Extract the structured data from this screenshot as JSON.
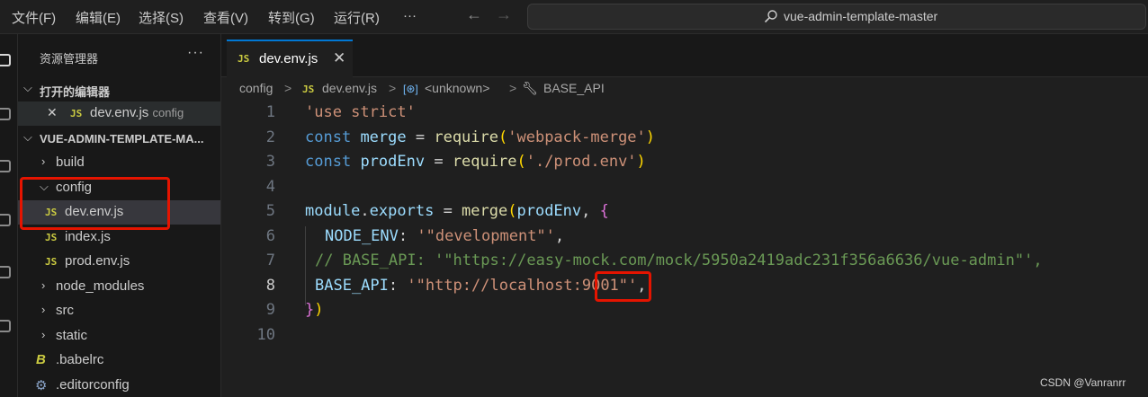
{
  "menu": [
    "文件(F)",
    "编辑(E)",
    "选择(S)",
    "查看(V)",
    "转到(G)",
    "运行(R)",
    "···"
  ],
  "nav": {
    "back": "←",
    "forward": "→"
  },
  "command_center": {
    "text": "vue-admin-template-master",
    "icon": "search-icon"
  },
  "sidebar": {
    "title": "资源管理器",
    "more": "···",
    "open_editors": {
      "title": "打开的编辑器",
      "items": [
        {
          "close": "✕",
          "badge": "JS",
          "name": "dev.env.js",
          "desc": "config"
        }
      ]
    },
    "project": {
      "title": "VUE-ADMIN-TEMPLATE-MA...",
      "folders": {
        "build": "build",
        "config": "config",
        "node_modules": "node_modules",
        "src": "src",
        "static": "static"
      },
      "config_files": [
        {
          "badge": "JS",
          "name": "dev.env.js"
        },
        {
          "badge": "JS",
          "name": "index.js"
        },
        {
          "badge": "JS",
          "name": "prod.env.js"
        }
      ],
      "babelrc": ".babelrc",
      "editorconfig": ".editorconfig"
    }
  },
  "tab": {
    "badge": "JS",
    "label": "dev.env.js",
    "close": "✕"
  },
  "breadcrumb": {
    "folder": "config",
    "file_badge": "JS",
    "file": "dev.env.js",
    "symbol1": "<unknown>",
    "symbol2": "BASE_API",
    "sep": ">"
  },
  "code": {
    "line_numbers": [
      "1",
      "2",
      "3",
      "4",
      "5",
      "6",
      "7",
      "8",
      "9",
      "10"
    ],
    "active_line": "8",
    "l1": {
      "s": "'use strict'"
    },
    "l2": {
      "kw": "const",
      "v": "merge",
      "eq": " = ",
      "fn": "require",
      "p1": "(",
      "s": "'webpack-merge'",
      "p2": ")"
    },
    "l3": {
      "kw": "const",
      "v": "prodEnv",
      "eq": " = ",
      "fn": "require",
      "p1": "(",
      "s": "'./prod.env'",
      "p2": ")"
    },
    "l5": {
      "m": "module",
      "dot": ".",
      "e": "exports",
      "eq": " = ",
      "fn": "merge",
      "p1": "(",
      "a": "prodEnv",
      "c": ", ",
      "b": "{"
    },
    "l6": {
      "k": "NODE_ENV",
      "c": ": ",
      "s": "'\"development\"'",
      "t": ","
    },
    "l7": {
      "cmt": "// BASE_API: '\"https://easy-mock.com/mock/5950a2419adc231f356a6636/vue-admin\"',"
    },
    "l8": {
      "k": "BASE_API",
      "c": ": ",
      "s1": "'\"http://localhost:",
      "port": "9001",
      "s2": "\"'",
      "t": ","
    },
    "l9": {
      "b": "}",
      "p": ")"
    }
  },
  "watermark": "CSDN @Vanranrr",
  "colors": {
    "accent": "#0078d4",
    "annotation": "#e51400",
    "js_badge": "#cbcb41"
  }
}
